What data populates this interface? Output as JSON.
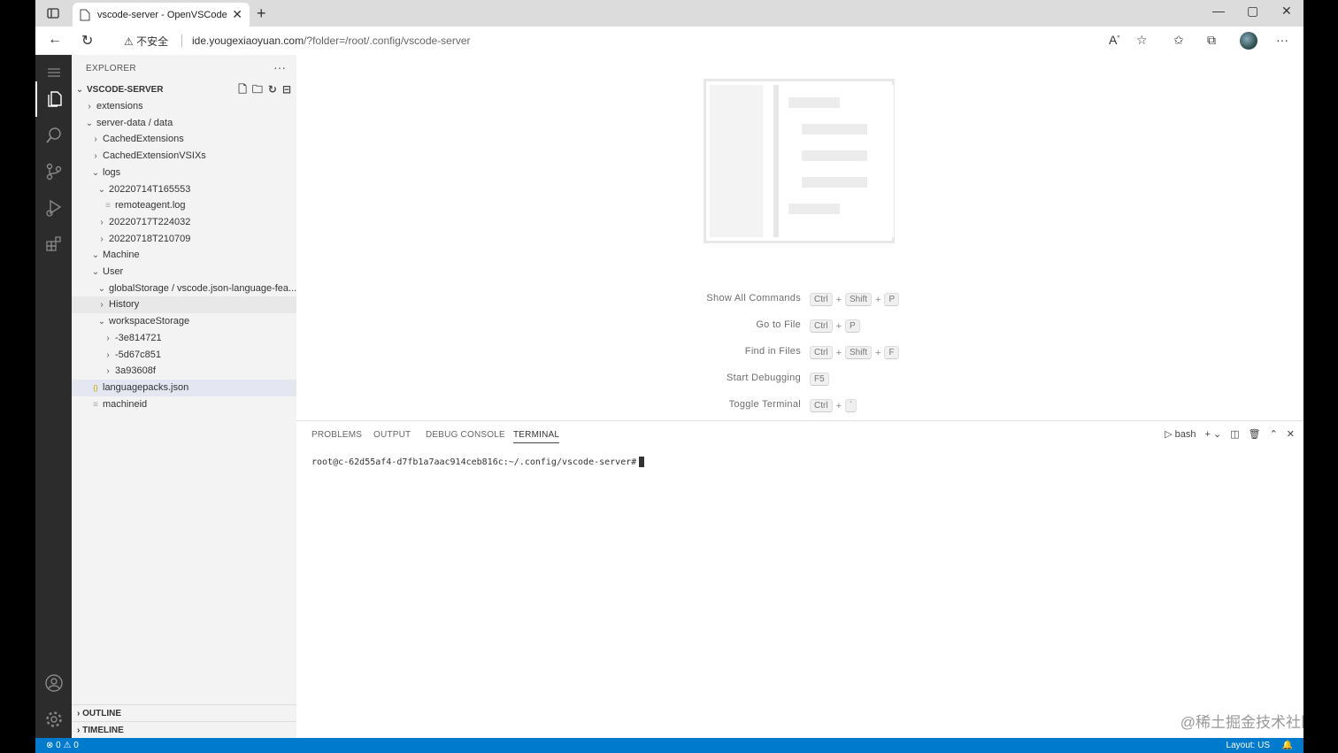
{
  "browser": {
    "tab_title": "vscode-server - OpenVSCode Se",
    "security_label": "不安全",
    "url_host": "ide.yougexiaoyuan.com",
    "url_rest": "/?folder=/root/.config/vscode-server"
  },
  "sidebar": {
    "explorer_title": "EXPLORER",
    "root": "VSCODE-SERVER",
    "tree": [
      {
        "label": "extensions",
        "indent": 1,
        "type": "folder",
        "open": false
      },
      {
        "label": "server-data / data",
        "indent": 1,
        "type": "folder",
        "open": true
      },
      {
        "label": "CachedExtensions",
        "indent": 2,
        "type": "folder",
        "open": false
      },
      {
        "label": "CachedExtensionVSIXs",
        "indent": 2,
        "type": "folder",
        "open": false
      },
      {
        "label": "logs",
        "indent": 2,
        "type": "folder",
        "open": true
      },
      {
        "label": "20220714T165553",
        "indent": 3,
        "type": "folder",
        "open": true
      },
      {
        "label": "remoteagent.log",
        "indent": 4,
        "type": "file"
      },
      {
        "label": "20220717T224032",
        "indent": 3,
        "type": "folder",
        "open": false
      },
      {
        "label": "20220718T210709",
        "indent": 3,
        "type": "folder",
        "open": false
      },
      {
        "label": "Machine",
        "indent": 2,
        "type": "folder",
        "open": true
      },
      {
        "label": "User",
        "indent": 2,
        "type": "folder",
        "open": true
      },
      {
        "label": "globalStorage / vscode.json-language-fea...",
        "indent": 3,
        "type": "folder",
        "open": true
      },
      {
        "label": "History",
        "indent": 3,
        "type": "folder",
        "open": false,
        "state": "hover"
      },
      {
        "label": "workspaceStorage",
        "indent": 3,
        "type": "folder",
        "open": true
      },
      {
        "label": "-3e814721",
        "indent": 4,
        "type": "folder",
        "open": false
      },
      {
        "label": "-5d67c851",
        "indent": 4,
        "type": "folder",
        "open": false
      },
      {
        "label": "3a93608f",
        "indent": 4,
        "type": "folder",
        "open": false
      },
      {
        "label": "languagepacks.json",
        "indent": 2,
        "type": "json",
        "state": "selected"
      },
      {
        "label": "machineid",
        "indent": 2,
        "type": "file"
      }
    ],
    "outline": "OUTLINE",
    "timeline": "TIMELINE"
  },
  "editor": {
    "shortcuts": [
      {
        "label": "Show All Commands",
        "keys": [
          "Ctrl",
          "Shift",
          "P"
        ]
      },
      {
        "label": "Go to File",
        "keys": [
          "Ctrl",
          "P"
        ]
      },
      {
        "label": "Find in Files",
        "keys": [
          "Ctrl",
          "Shift",
          "F"
        ]
      },
      {
        "label": "Start Debugging",
        "keys": [
          "F5"
        ]
      },
      {
        "label": "Toggle Terminal",
        "keys": [
          "Ctrl",
          "`"
        ]
      }
    ]
  },
  "panel": {
    "tabs": [
      "PROBLEMS",
      "OUTPUT",
      "DEBUG CONSOLE",
      "TERMINAL"
    ],
    "active_tab": "TERMINAL",
    "shell": "bash",
    "terminal_line": "root@c-62d55af4-d7fb1a7aac914ceb816c:~/.config/vscode-server#"
  },
  "status": {
    "errors": "0",
    "warnings": "0",
    "layout": "Layout: US"
  },
  "watermark": "@稀土掘金技术社区"
}
